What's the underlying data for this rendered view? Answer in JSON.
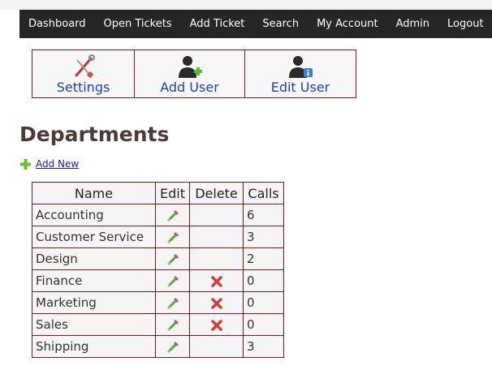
{
  "nav": {
    "items": [
      "Dashboard",
      "Open Tickets",
      "Add Ticket",
      "Search",
      "My Account",
      "Admin",
      "Logout"
    ]
  },
  "toolbar": {
    "settings_label": "Settings",
    "add_user_label": "Add User",
    "edit_user_label": "Edit User",
    "border_color": "#7a1a1a",
    "label_color": "#1a3fbf"
  },
  "page": {
    "heading": "Departments",
    "add_new_label": "Add New"
  },
  "table": {
    "headers": {
      "name": "Name",
      "edit": "Edit",
      "delete": "Delete",
      "calls": "Calls"
    },
    "rows": [
      {
        "name": "Accounting",
        "calls": "6",
        "deletable": false
      },
      {
        "name": "Customer Service",
        "calls": "3",
        "deletable": false
      },
      {
        "name": "Design",
        "calls": "2",
        "deletable": false
      },
      {
        "name": "Finance",
        "calls": "0",
        "deletable": true
      },
      {
        "name": "Marketing",
        "calls": "0",
        "deletable": true
      },
      {
        "name": "Sales",
        "calls": "0",
        "deletable": true
      },
      {
        "name": "Shipping",
        "calls": "3",
        "deletable": false
      }
    ]
  },
  "icons": {
    "settings": "wrench-screwdriver-icon",
    "add_user": "user-add-icon",
    "edit_user": "user-edit-icon",
    "edit_row": "pencil-icon",
    "delete_row": "red-x-icon",
    "add_new": "green-plus-icon"
  }
}
